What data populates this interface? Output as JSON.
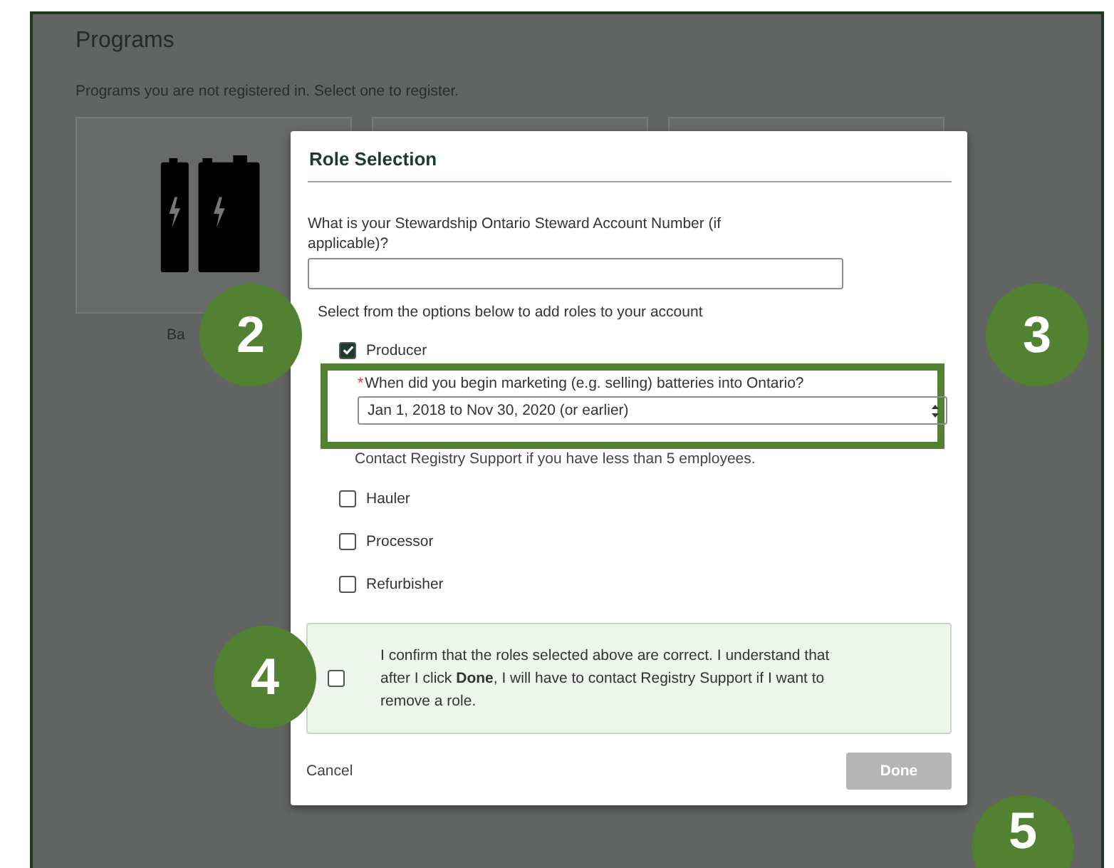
{
  "page": {
    "title": "Programs",
    "subtitle": "Programs you are not registered in. Select one to register.",
    "cards": [
      {
        "label": "Ba",
        "icon": true
      }
    ]
  },
  "modal": {
    "title": "Role Selection",
    "account_question": "What is your Stewardship Ontario Steward Account Number (if applicable)?",
    "roles_prompt": "Select from the options below to add roles to your account",
    "roles": [
      {
        "label": "Producer",
        "checked": true
      },
      {
        "label": "Hauler",
        "checked": false
      },
      {
        "label": "Processor",
        "checked": false
      },
      {
        "label": "Refurbisher",
        "checked": false
      }
    ],
    "producer_question": {
      "required_mark": "*",
      "label": "When did you begin marketing (e.g. selling) batteries into Ontario?",
      "value": "Jan 1, 2018 to Nov 30, 2020 (or earlier)"
    },
    "note": "Contact Registry Support if you have less than 5 employees.",
    "confirmation": {
      "checked": false,
      "text": "I confirm that the roles selected above are correct. I understand that after I click **Done**, I will have to contact Registry Support if I want to remove a role."
    },
    "buttons": [
      {
        "label": "Cancel",
        "kind": "link",
        "disabled": false
      },
      {
        "label": "Done",
        "kind": "primary",
        "disabled": true
      }
    ]
  },
  "callouts": [
    {
      "number": "2"
    },
    {
      "number": "3"
    },
    {
      "number": "4"
    },
    {
      "number": "5"
    }
  ]
}
